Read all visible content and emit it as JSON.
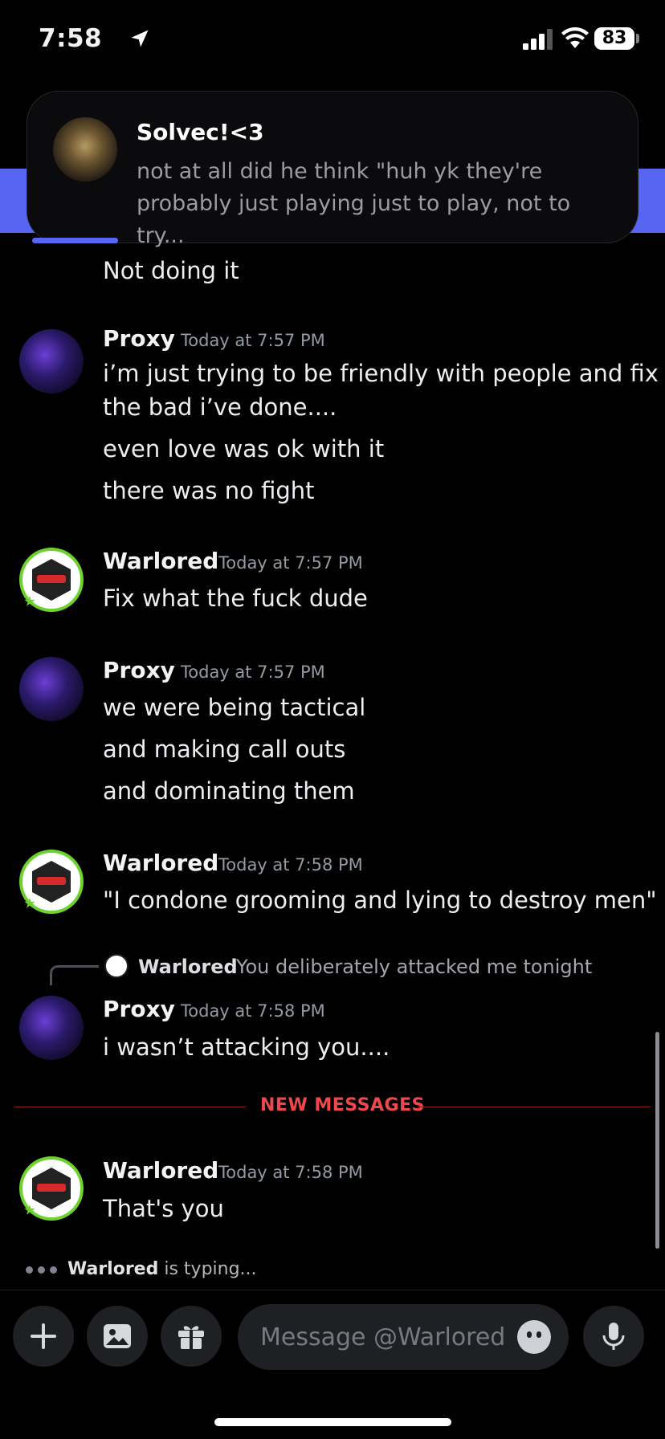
{
  "status_bar": {
    "time": "7:58",
    "battery": "83"
  },
  "notification": {
    "sender": "Solvec!<3",
    "preview": "not at all did he think \"huh yk they're probably just playing just to play, not to try..."
  },
  "messages": {
    "m0": {
      "lines": [
        "Not doing it"
      ]
    },
    "m1": {
      "author": "Proxy",
      "time": "Today at 7:57 PM",
      "lines": [
        "i’m just trying to be friendly with people and fix all",
        "the bad i’ve done....",
        "even love was ok with it",
        "there was no fight"
      ]
    },
    "m2": {
      "author": "Warlored",
      "time": "Today at 7:57 PM",
      "lines": [
        "Fix what the fuck dude"
      ]
    },
    "m3": {
      "author": "Proxy",
      "time": "Today at 7:57 PM",
      "lines": [
        "we were being tactical",
        "and making call outs",
        "and dominating them"
      ]
    },
    "m4": {
      "author": "Warlored",
      "time": "Today at 7:58 PM",
      "lines": [
        "\"I condone grooming and lying to destroy men\""
      ]
    },
    "m5": {
      "reply_author": "Warlored",
      "reply_text": "You deliberately attacked me tonight",
      "author": "Proxy",
      "time": "Today at 7:58 PM",
      "lines": [
        "i wasn’t attacking you...."
      ]
    },
    "m6": {
      "author": "Warlored",
      "time": "Today at 7:58 PM",
      "lines": [
        "That's you"
      ]
    }
  },
  "new_messages_label": "NEW MESSAGES",
  "typing": {
    "user": "Warlored",
    "suffix": " is typing..."
  },
  "composer": {
    "placeholder": "Message @Warlored"
  },
  "colors": {
    "blurple": "#5865f2",
    "new_messages": "#f0474a",
    "online_green": "#6cd22c"
  }
}
